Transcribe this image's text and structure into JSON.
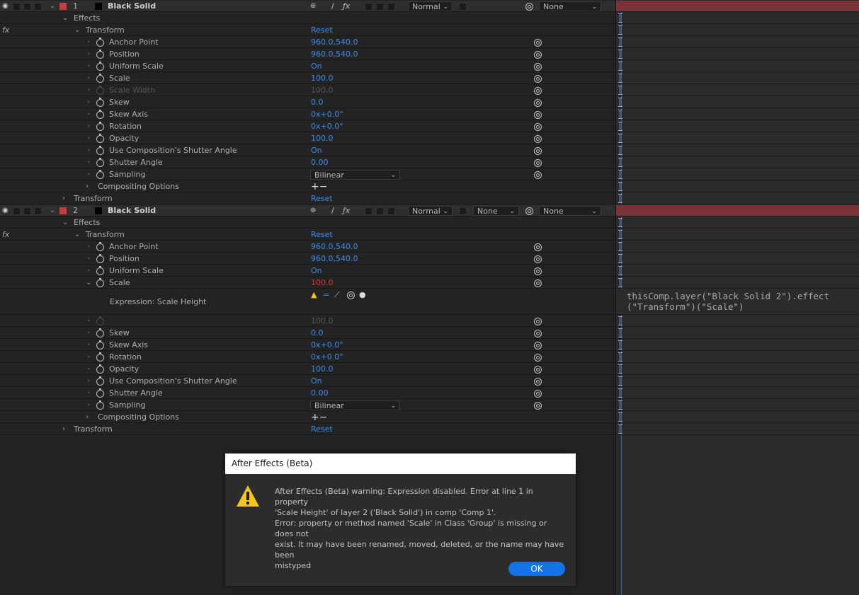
{
  "layers": [
    {
      "number": "1",
      "name": "Black Solid",
      "mode": "Normal",
      "trkmat": "",
      "parent": "None"
    },
    {
      "number": "2",
      "name": "Black Solid",
      "mode": "Normal",
      "trkmat": "None",
      "parent": "None"
    }
  ],
  "labels": {
    "effects": "Effects",
    "transform": "Transform",
    "reset": "Reset",
    "fx": "fx",
    "compositing_options": "Compositing Options",
    "plus_minus": "+−",
    "expression_label": "Expression: Scale Height"
  },
  "layer1_props": [
    {
      "name": "Anchor Point",
      "value": "960.0,540.0"
    },
    {
      "name": "Position",
      "value": "960.0,540.0"
    },
    {
      "name": "Uniform Scale",
      "value": "On"
    },
    {
      "name": "Scale",
      "value": "100.0"
    },
    {
      "name": "Scale Width",
      "value": "100.0"
    },
    {
      "name": "Skew",
      "value": "0.0"
    },
    {
      "name": "Skew Axis",
      "value": "0x+0.0°"
    },
    {
      "name": "Rotation",
      "value": "0x+0.0°"
    },
    {
      "name": "Opacity",
      "value": "100.0"
    },
    {
      "name": "Use Composition's Shutter Angle",
      "value": "On"
    },
    {
      "name": "Shutter Angle",
      "value": "0.00"
    },
    {
      "name": "Sampling",
      "value": "Bilinear"
    }
  ],
  "layer2_props": [
    {
      "name": "Anchor Point",
      "value": "960.0,540.0"
    },
    {
      "name": "Position",
      "value": "960.0,540.0"
    },
    {
      "name": "Uniform Scale",
      "value": "On"
    },
    {
      "name": "Scale",
      "value": "100.0"
    },
    {
      "name": "",
      "value": "100.0"
    },
    {
      "name": "Skew",
      "value": "0.0"
    },
    {
      "name": "Skew Axis",
      "value": "0x+0.0°"
    },
    {
      "name": "Rotation",
      "value": "0x+0.0°"
    },
    {
      "name": "Opacity",
      "value": "100.0"
    },
    {
      "name": "Use Composition's Shutter Angle",
      "value": "On"
    },
    {
      "name": "Shutter Angle",
      "value": "0.00"
    },
    {
      "name": "Sampling",
      "value": "Bilinear"
    }
  ],
  "expression_text": "thisComp.layer(\"Black Solid 2\").effect\n(\"Transform\")(\"Scale\")",
  "dialog": {
    "title": "After Effects (Beta)",
    "message": "After Effects (Beta) warning: Expression disabled. Error at line 1 in property\n'Scale Height' of layer 2 ('Black Solid') in comp 'Comp 1'.\nError: property or method named 'Scale' in Class 'Group' is missing or does not\nexist. It may have been renamed, moved, deleted, or the name may have been\nmistyped",
    "ok_label": "OK"
  },
  "colors": {
    "value_blue": "#3d8dea",
    "error_red": "#d8373b",
    "layer_label_red": "#c53d3d",
    "timeline_bar": "#7a3236",
    "ok_button": "#1473e6",
    "warning_yellow": "#f5c518"
  }
}
